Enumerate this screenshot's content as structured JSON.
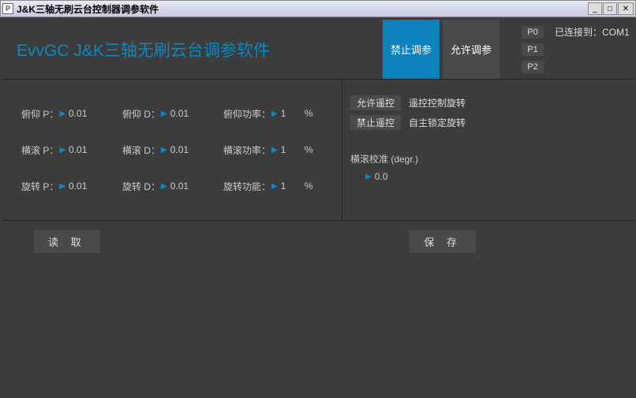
{
  "window": {
    "title": "J&K三轴无刷云台控制器调参软件",
    "icon_letter": "P"
  },
  "header": {
    "app_title": "EvvGC J&K三轴无刷云台调参软件",
    "stop_param": "禁止调参",
    "allow_param": "允许调参",
    "port_status": "已连接到：COM1",
    "p0": "P0",
    "p1": "P1",
    "p2": "P2"
  },
  "params": {
    "pitch": {
      "p_label": "俯仰 P：",
      "p_val": "0.01",
      "d_label": "俯仰 D：",
      "d_val": "0.01",
      "pwr_label": "俯仰功率：",
      "pwr_val": "1"
    },
    "roll": {
      "p_label": "横滚 P：",
      "p_val": "0.01",
      "d_label": "横滚 D：",
      "d_val": "0.01",
      "pwr_label": "横滚功率：",
      "pwr_val": "1"
    },
    "yaw": {
      "p_label": "旋转 P：",
      "p_val": "0.01",
      "d_label": "旋转 D：",
      "d_val": "0.01",
      "pwr_label": "旋转功能：",
      "pwr_val": "1"
    },
    "percent": "%"
  },
  "remote": {
    "allow": "允许遥控",
    "allow_desc": "遥控控制旋转",
    "deny": "禁止遥控",
    "deny_desc": "自主锁定旋转"
  },
  "rollcal": {
    "label": "横滚校准 (degr.)",
    "val": "0.0"
  },
  "actions": {
    "read": "读 取",
    "save": "保 存"
  }
}
